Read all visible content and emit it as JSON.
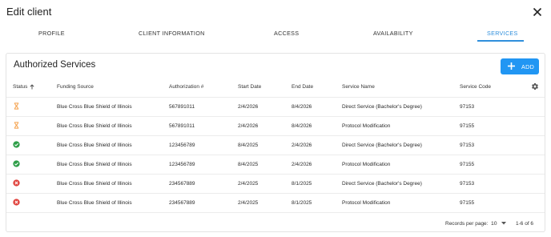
{
  "dialog": {
    "title": "Edit client"
  },
  "tabs": [
    {
      "label": "PROFILE",
      "active": false
    },
    {
      "label": "CLIENT INFORMATION",
      "active": false
    },
    {
      "label": "ACCESS",
      "active": false
    },
    {
      "label": "AVAILABILITY",
      "active": false
    },
    {
      "label": "SERVICES",
      "active": true
    }
  ],
  "section": {
    "title": "Authorized Services",
    "add_label": "ADD"
  },
  "table": {
    "columns": [
      "Status",
      "Funding Source",
      "Authorization #",
      "Start Date",
      "End Date",
      "Service Name",
      "Service Code"
    ],
    "sort": {
      "column": "Status",
      "direction": "asc"
    },
    "rows": [
      {
        "status": "pending",
        "funding": "Blue Cross Blue Shield of Illinois",
        "auth": "567891011",
        "start": "2/4/2026",
        "end": "8/4/2026",
        "service": "Direct Service (Bachelor's Degree)",
        "code": "97153"
      },
      {
        "status": "pending",
        "funding": "Blue Cross Blue Shield of Illinois",
        "auth": "567891011",
        "start": "2/4/2026",
        "end": "8/4/2026",
        "service": "Protocol Modification",
        "code": "97155"
      },
      {
        "status": "active",
        "funding": "Blue Cross Blue Shield of Illinois",
        "auth": "123456789",
        "start": "8/4/2025",
        "end": "2/4/2026",
        "service": "Direct Service (Bachelor's Degree)",
        "code": "97153"
      },
      {
        "status": "active",
        "funding": "Blue Cross Blue Shield of Illinois",
        "auth": "123456789",
        "start": "8/4/2025",
        "end": "2/4/2026",
        "service": "Protocol Modification",
        "code": "97155"
      },
      {
        "status": "expired",
        "funding": "Blue Cross Blue Shield of Illinois",
        "auth": "234567889",
        "start": "2/4/2025",
        "end": "8/1/2025",
        "service": "Direct Service (Bachelor's Degree)",
        "code": "97153"
      },
      {
        "status": "expired",
        "funding": "Blue Cross Blue Shield of Illinois",
        "auth": "234567889",
        "start": "2/4/2025",
        "end": "8/1/2025",
        "service": "Protocol Modification",
        "code": "97155"
      }
    ]
  },
  "pagination": {
    "rows_per_page_label": "Records per page:",
    "rows_per_page": "10",
    "range": "1-6 of 6"
  },
  "colors": {
    "accent": "#2196f3",
    "pending": "#f5a04a",
    "active": "#2e9e48",
    "expired": "#e0443e"
  },
  "icons": {
    "close": "close-icon",
    "add": "plus-icon",
    "sort": "arrow-up-icon",
    "settings": "gear-icon",
    "pending": "hourglass-icon",
    "active": "check-circle-icon",
    "expired": "x-circle-icon",
    "dropdown": "caret-down-icon"
  }
}
